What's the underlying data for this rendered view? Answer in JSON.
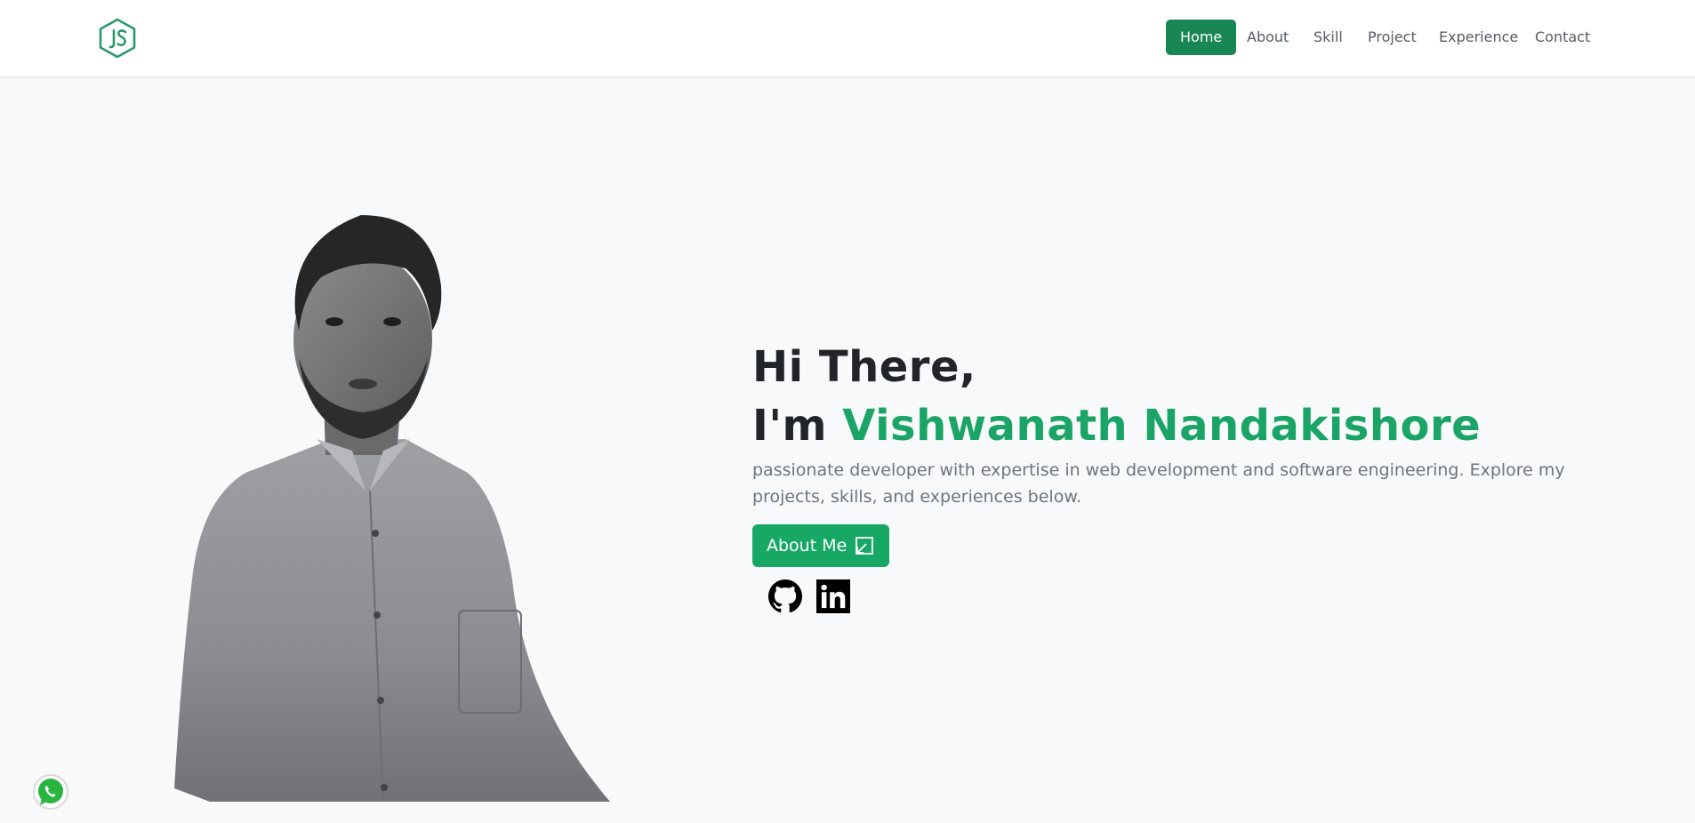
{
  "nav": {
    "logo_icon": "nodejs-hexagon-logo-icon",
    "items": [
      {
        "label": "Home",
        "active": true
      },
      {
        "label": "About",
        "active": false
      },
      {
        "label": "Skill",
        "active": false
      },
      {
        "label": "Project",
        "active": false
      },
      {
        "label": "Experience",
        "active": false
      },
      {
        "label": "Contact",
        "active": false
      }
    ]
  },
  "hero": {
    "greeting_line1": "Hi There,",
    "greeting_prefix": "I'm ",
    "name": "Vishwanath Nandakishore",
    "tagline": "passionate developer with expertise in web development and software engineering. Explore my projects, skills, and experiences below.",
    "about_button": "About Me",
    "about_button_icon": "external-arrow-icon",
    "socials": [
      {
        "name": "github-icon"
      },
      {
        "name": "linkedin-icon"
      }
    ],
    "portrait": "grayscale-portrait-photo"
  },
  "floating": {
    "whatsapp_icon": "whatsapp-icon"
  },
  "colors": {
    "accent": "#1aa466",
    "nav_active": "#198754",
    "background": "#f8f9fa",
    "text": "#212529",
    "muted": "#6c757d"
  }
}
